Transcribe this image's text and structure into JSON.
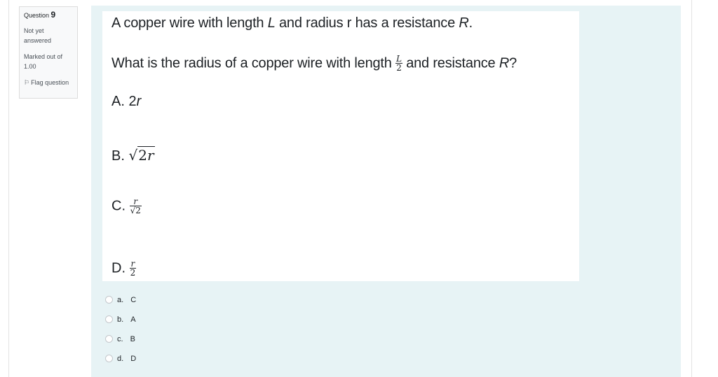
{
  "info": {
    "question_label": "Question",
    "question_number": "9",
    "state": "Not yet answered",
    "grade": "Marked out of 1.00",
    "flag": "Flag question"
  },
  "question": {
    "line1_prefix": "A copper wire with length ",
    "line1_L": "L",
    "line1_mid": " and radius r has a resistance ",
    "line1_R": "R",
    "line1_end": ".",
    "line2_prefix": "What is the radius of a copper wire with length ",
    "line2_frac_num": "L",
    "line2_frac_den": "2",
    "line2_mid": " and resistance ",
    "line2_R": "R",
    "line2_end": "?"
  },
  "options": {
    "a": {
      "letter": "A.",
      "coef": "2",
      "var": "r"
    },
    "b": {
      "letter": "B.",
      "radicand": "2",
      "var": "r"
    },
    "c": {
      "letter": "C.",
      "num": "r",
      "den": "√2"
    },
    "d": {
      "letter": "D.",
      "num": "r",
      "den": "2"
    }
  },
  "answers": [
    {
      "label": "a.",
      "text": "C"
    },
    {
      "label": "b.",
      "text": "A"
    },
    {
      "label": "c.",
      "text": "B"
    },
    {
      "label": "d.",
      "text": "D"
    }
  ]
}
